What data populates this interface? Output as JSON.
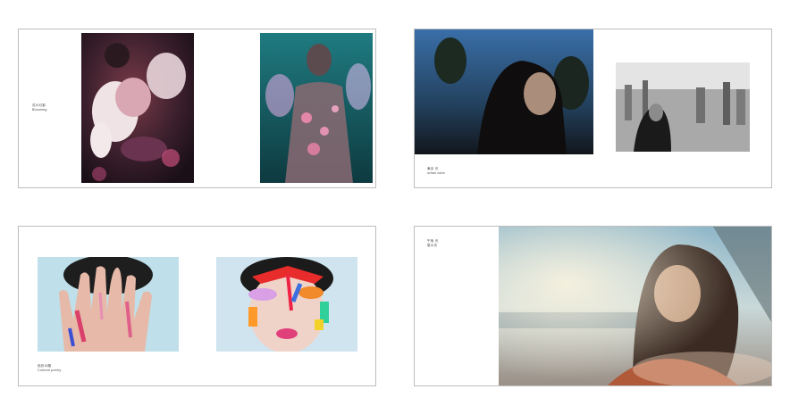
{
  "spreads": [
    {
      "name": "spread-1",
      "captions": {
        "title": "花の幻影",
        "subtitle": "Blooming"
      },
      "photos": [
        {
          "name": "flower-portrait-photo",
          "description": "woman lying among pink and white flowers, dark moody tones"
        },
        {
          "name": "teal-projection-photo",
          "description": "woman in transparent jacket with pink light projections on teal background"
        }
      ]
    },
    {
      "name": "spread-2",
      "captions": {
        "title": "東京 光",
        "subtitle": "urban calm"
      },
      "photos": [
        {
          "name": "dusk-profile-photo",
          "description": "woman in profile at dusk, blue sky and trees behind"
        },
        {
          "name": "city-skyline-bw-photo",
          "description": "black and white woman in front of city skyline"
        }
      ]
    },
    {
      "name": "spread-3",
      "captions": {
        "title": "色彩の顏",
        "subtitle": "Colored poetry"
      },
      "photos": [
        {
          "name": "painted-hands-photo",
          "description": "hands with colorful paint covering face"
        },
        {
          "name": "painted-face-photo",
          "description": "face painted with bright red, blue, yellow and green strokes"
        }
      ]
    },
    {
      "name": "spread-4",
      "captions": {
        "title": "午後 光",
        "subtitle": "夏の光"
      },
      "photos": [
        {
          "name": "car-window-sunlight-photo",
          "description": "woman by car window in warm sunlight, sea and sky behind"
        }
      ]
    }
  ],
  "colors": {
    "border": "#bdbdbd",
    "caption_text": "#444444",
    "background": "#ffffff"
  }
}
